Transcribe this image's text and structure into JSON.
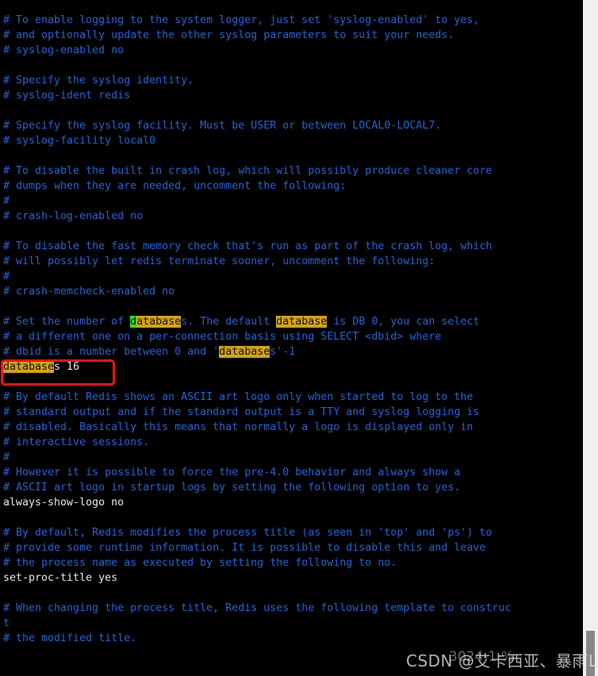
{
  "app": {
    "kind": "terminal-text-editor",
    "file_kind": "redis-configuration-file",
    "background": "#000000",
    "comment_color": "#1d65d8",
    "plain_color": "#e8e8e8",
    "match_highlight_color": "#d4a213",
    "current_match_highlight_color": "#27e327",
    "annotation_box_color": "#fb1404"
  },
  "search": {
    "term": "database",
    "current_match_char": "d"
  },
  "lines": [
    {
      "type": "comment",
      "text": "# To enable logging to the system logger, just set 'syslog-enabled' to yes,"
    },
    {
      "type": "comment",
      "text": "# and optionally update the other syslog parameters to suit your needs."
    },
    {
      "type": "comment",
      "text": "# syslog-enabled no"
    },
    {
      "type": "blank",
      "text": ""
    },
    {
      "type": "comment",
      "text": "# Specify the syslog identity."
    },
    {
      "type": "comment",
      "text": "# syslog-ident redis"
    },
    {
      "type": "blank",
      "text": ""
    },
    {
      "type": "comment",
      "text": "# Specify the syslog facility. Must be USER or between LOCAL0-LOCAL7."
    },
    {
      "type": "comment",
      "text": "# syslog-facility local0"
    },
    {
      "type": "blank",
      "text": ""
    },
    {
      "type": "comment",
      "text": "# To disable the built in crash log, which will possibly produce cleaner core"
    },
    {
      "type": "comment",
      "text": "# dumps when they are needed, uncomment the following:"
    },
    {
      "type": "comment",
      "text": "#"
    },
    {
      "type": "comment",
      "text": "# crash-log-enabled no"
    },
    {
      "type": "blank",
      "text": ""
    },
    {
      "type": "comment",
      "text": "# To disable the fast memory check that's run as part of the crash log, which"
    },
    {
      "type": "comment",
      "text": "# will possibly let redis terminate sooner, uncomment the following:"
    },
    {
      "type": "comment",
      "text": "#"
    },
    {
      "type": "comment",
      "text": "# crash-memcheck-enabled no"
    },
    {
      "type": "blank",
      "text": ""
    },
    {
      "type": "comment",
      "text": "# Set the number of databases. The default database is DB 0, you can select",
      "segments": [
        {
          "style": "comment",
          "text": "# Set the number of "
        },
        {
          "style": "current",
          "text": "d"
        },
        {
          "style": "match",
          "text": "atabase"
        },
        {
          "style": "comment",
          "text": "s. The default "
        },
        {
          "style": "match",
          "text": "database"
        },
        {
          "style": "comment",
          "text": " is DB 0, you can select"
        }
      ]
    },
    {
      "type": "comment",
      "text": "# a different one on a per-connection basis using SELECT <dbid> where"
    },
    {
      "type": "comment",
      "text": "# dbid is a number between 0 and 'databases'-1",
      "segments": [
        {
          "style": "comment",
          "text": "# dbid is a number between 0 and '"
        },
        {
          "style": "match",
          "text": "database"
        },
        {
          "style": "comment",
          "text": "s'-1"
        }
      ]
    },
    {
      "type": "plain",
      "text": "databases 16",
      "segments": [
        {
          "style": "match",
          "text": "database"
        },
        {
          "style": "plain",
          "text": "s 16"
        }
      ]
    },
    {
      "type": "blank",
      "text": ""
    },
    {
      "type": "comment",
      "text": "# By default Redis shows an ASCII art logo only when started to log to the"
    },
    {
      "type": "comment",
      "text": "# standard output and if the standard output is a TTY and syslog logging is"
    },
    {
      "type": "comment",
      "text": "# disabled. Basically this means that normally a logo is displayed only in"
    },
    {
      "type": "comment",
      "text": "# interactive sessions."
    },
    {
      "type": "comment",
      "text": "#"
    },
    {
      "type": "comment",
      "text": "# However it is possible to force the pre-4.0 behavior and always show a"
    },
    {
      "type": "comment",
      "text": "# ASCII art logo in startup logs by setting the following option to yes."
    },
    {
      "type": "plain",
      "text": "always-show-logo no"
    },
    {
      "type": "blank",
      "text": ""
    },
    {
      "type": "comment",
      "text": "# By default, Redis modifies the process title (as seen in 'top' and 'ps') to"
    },
    {
      "type": "comment",
      "text": "# provide some runtime information. It is possible to disable this and leave"
    },
    {
      "type": "comment",
      "text": "# the process name as executed by setting the following to no."
    },
    {
      "type": "plain",
      "text": "set-proc-title yes"
    },
    {
      "type": "blank",
      "text": ""
    },
    {
      "type": "comment",
      "text": "# When changing the process title, Redis uses the following template to construc"
    },
    {
      "type": "comment",
      "text": "t"
    },
    {
      "type": "comment",
      "text": "# the modified title."
    }
  ],
  "annotation": {
    "target_line": "databases 16",
    "shape": "rectangle"
  },
  "scrollbar": {
    "orientation": "vertical",
    "thumb_position": "bottom"
  },
  "watermark": {
    "main": "CSDN @艾卡西亚、暴雨L",
    "ghost": "3024-1·%"
  }
}
